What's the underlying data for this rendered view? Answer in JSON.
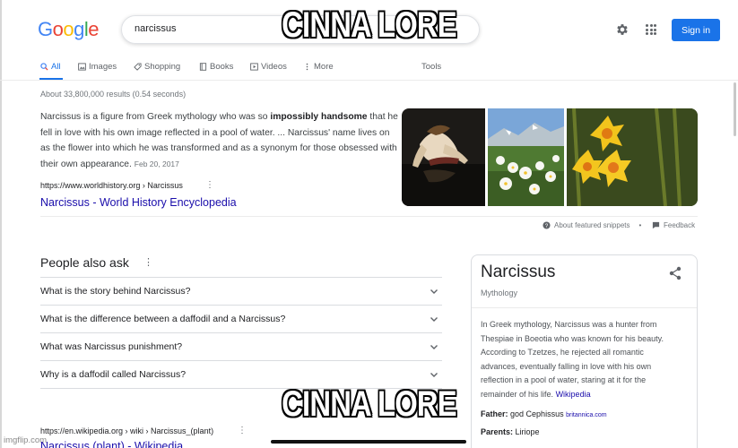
{
  "header": {
    "logo_letters": [
      "G",
      "o",
      "o",
      "g",
      "l",
      "e"
    ],
    "logo_colors": [
      "#4285F4",
      "#EA4335",
      "#FBBC05",
      "#4285F4",
      "#34A853",
      "#EA4335"
    ],
    "search_query": "narcissus",
    "settings_icon": "gear-icon",
    "apps_icon": "apps-grid-icon",
    "signin_label": "Sign in"
  },
  "tabs": [
    {
      "label": "All",
      "icon": "search-icon"
    },
    {
      "label": "Images",
      "icon": "image-icon"
    },
    {
      "label": "Shopping",
      "icon": "tag-icon"
    },
    {
      "label": "Books",
      "icon": "book-icon"
    },
    {
      "label": "Videos",
      "icon": "play-icon"
    },
    {
      "label": "More",
      "icon": "kebab-icon"
    },
    {
      "label": "Tools",
      "icon": ""
    }
  ],
  "results_stats": "About 33,800,000 results (0.54 seconds)",
  "featured_snippet": {
    "text_before": "Narcissus is a figure from Greek mythology who was so ",
    "text_bold": "impossibly handsome",
    "text_after": " that he fell in love with his own image reflected in a pool of water. ... Narcissus' name lives on as the flower into which he was transformed and as a synonym for those obsessed with their own appearance.",
    "date": "Feb 20, 2017",
    "url": "https://www.worldhistory.org › Narcissus",
    "title": "Narcissus - World History Encyclopedia",
    "about_label": "About featured snippets",
    "separator": "•",
    "feedback_label": "Feedback"
  },
  "people_also_ask": {
    "title": "People also ask",
    "questions": [
      "What is the story behind Narcissus?",
      "What is the difference between a daffodil and a Narcissus?",
      "What was Narcissus punishment?",
      "Why is a daffodil called Narcissus?"
    ]
  },
  "second_result": {
    "url": "https://en.wikipedia.org › wiki › Narcissus_(plant)",
    "title": "Narcissus (plant) - Wikipedia"
  },
  "knowledge_panel": {
    "title": "Narcissus",
    "subtitle": "Mythology",
    "description": "In Greek mythology, Narcissus was a hunter from Thespiae in Boeotia who was known for his beauty. According to Tzetzes, he rejected all romantic advances, eventually falling in love with his own reflection in a pool of water, staring at it for the remainder of his life.",
    "description_link": "Wikipedia",
    "father_label": "Father:",
    "father_value": "god Cephissus",
    "father_source": "britannica.com",
    "parents_label": "Parents:",
    "parents_value": "Liriope"
  },
  "meme": {
    "top_caption": "CINNA LORE",
    "bottom_caption": "CINNA LORE",
    "watermark": "imgflip.com"
  }
}
